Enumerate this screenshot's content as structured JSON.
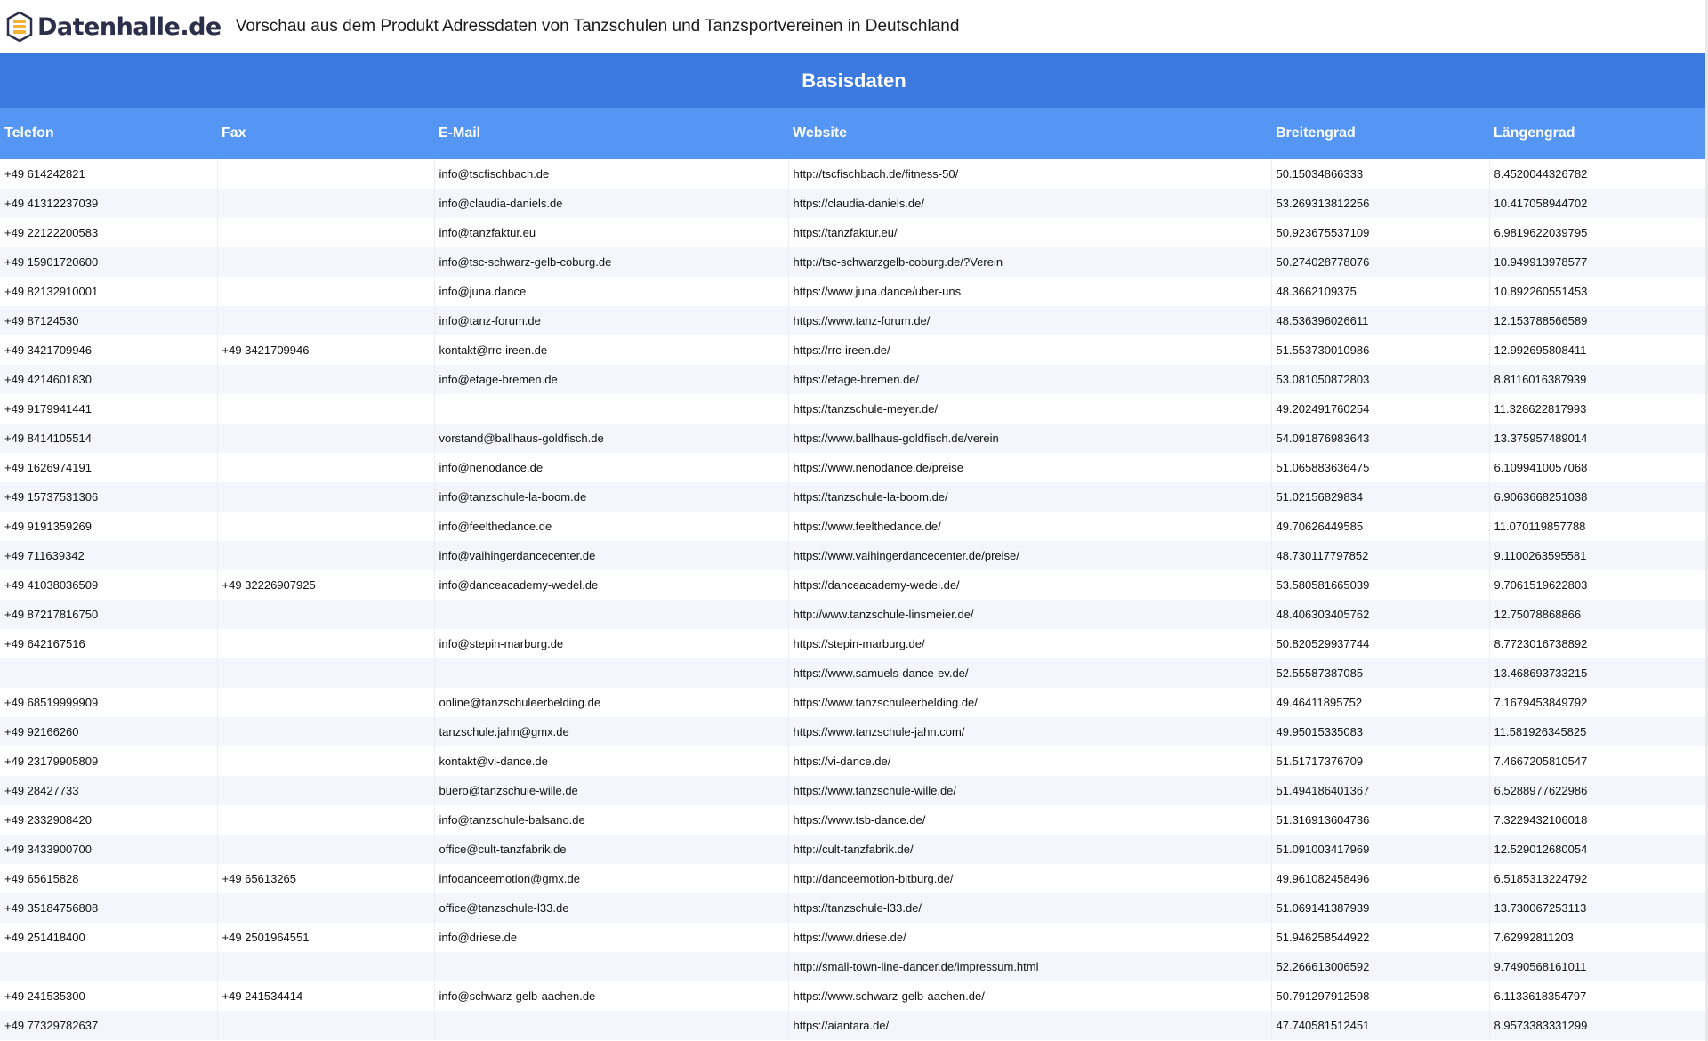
{
  "header": {
    "logo_text": "Datenhalle.de",
    "title": "Vorschau aus dem Produkt Adressdaten von Tanzschulen und Tanzsportvereinen in Deutschland"
  },
  "colors": {
    "section_header_bg": "#3c7ae0",
    "column_header_bg": "#5596f5",
    "row_alt_bg": "#f3f6fc"
  },
  "section": {
    "title": "Basisdaten"
  },
  "columns": [
    "Telefon",
    "Fax",
    "E-Mail",
    "Website",
    "Breitengrad",
    "Längengrad"
  ],
  "rows": [
    [
      "+49 614242821",
      "",
      "info@tscfischbach.de",
      "http://tscfischbach.de/fitness-50/",
      "50.15034866333",
      "8.4520044326782"
    ],
    [
      "+49 41312237039",
      "",
      "info@claudia-daniels.de",
      "https://claudia-daniels.de/",
      "53.269313812256",
      "10.417058944702"
    ],
    [
      "+49 22122200583",
      "",
      "info@tanzfaktur.eu",
      "https://tanzfaktur.eu/",
      "50.923675537109",
      "6.9819622039795"
    ],
    [
      "+49 15901720600",
      "",
      "info@tsc-schwarz-gelb-coburg.de",
      "http://tsc-schwarzgelb-coburg.de/?Verein",
      "50.274028778076",
      "10.949913978577"
    ],
    [
      "+49 82132910001",
      "",
      "info@juna.dance",
      "https://www.juna.dance/uber-uns",
      "48.3662109375",
      "10.892260551453"
    ],
    [
      "+49 87124530",
      "",
      "info@tanz-forum.de",
      "https://www.tanz-forum.de/",
      "48.536396026611",
      "12.153788566589"
    ],
    [
      "+49 3421709946",
      "+49 3421709946",
      "kontakt@rrc-ireen.de",
      "https://rrc-ireen.de/",
      "51.553730010986",
      "12.992695808411"
    ],
    [
      "+49 4214601830",
      "",
      "info@etage-bremen.de",
      "https://etage-bremen.de/",
      "53.081050872803",
      "8.8116016387939"
    ],
    [
      "+49 9179941441",
      "",
      "",
      "https://tanzschule-meyer.de/",
      "49.202491760254",
      "11.328622817993"
    ],
    [
      "+49 8414105514",
      "",
      "vorstand@ballhaus-goldfisch.de",
      "https://www.ballhaus-goldfisch.de/verein",
      "54.091876983643",
      "13.375957489014"
    ],
    [
      "+49 1626974191",
      "",
      "info@nenodance.de",
      "https://www.nenodance.de/preise",
      "51.065883636475",
      "6.1099410057068"
    ],
    [
      "+49 15737531306",
      "",
      "info@tanzschule-la-boom.de",
      "https://tanzschule-la-boom.de/",
      "51.02156829834",
      "6.9063668251038"
    ],
    [
      "+49 9191359269",
      "",
      "info@feelthedance.de",
      "https://www.feelthedance.de/",
      "49.70626449585",
      "11.070119857788"
    ],
    [
      "+49 711639342",
      "",
      "info@vaihingerdancecenter.de",
      "https://www.vaihingerdancecenter.de/preise/",
      "48.730117797852",
      "9.1100263595581"
    ],
    [
      "+49 41038036509",
      "+49 32226907925",
      "info@danceacademy-wedel.de",
      "https://danceacademy-wedel.de/",
      "53.580581665039",
      "9.7061519622803"
    ],
    [
      "+49 87217816750",
      "",
      "",
      "http://www.tanzschule-linsmeier.de/",
      "48.406303405762",
      "12.75078868866"
    ],
    [
      "+49 642167516",
      "",
      "info@stepin-marburg.de",
      "https://stepin-marburg.de/",
      "50.820529937744",
      "8.7723016738892"
    ],
    [
      "",
      "",
      "",
      "https://www.samuels-dance-ev.de/",
      "52.55587387085",
      "13.468693733215"
    ],
    [
      "+49 68519999909",
      "",
      "online@tanzschuleerbelding.de",
      "https://www.tanzschuleerbelding.de/",
      "49.46411895752",
      "7.1679453849792"
    ],
    [
      "+49 92166260",
      "",
      "tanzschule.jahn@gmx.de",
      "https://www.tanzschule-jahn.com/",
      "49.95015335083",
      "11.581926345825"
    ],
    [
      "+49 23179905809",
      "",
      "kontakt@vi-dance.de",
      "https://vi-dance.de/",
      "51.51717376709",
      "7.4667205810547"
    ],
    [
      "+49 28427733",
      "",
      "buero@tanzschule-wille.de",
      "https://www.tanzschule-wille.de/",
      "51.494186401367",
      "6.5288977622986"
    ],
    [
      "+49 2332908420",
      "",
      "info@tanzschule-balsano.de",
      "https://www.tsb-dance.de/",
      "51.316913604736",
      "7.3229432106018"
    ],
    [
      "+49 3433900700",
      "",
      "office@cult-tanzfabrik.de",
      "http://cult-tanzfabrik.de/",
      "51.091003417969",
      "12.529012680054"
    ],
    [
      "+49 65615828",
      "+49 65613265",
      "infodanceemotion@gmx.de",
      "http://danceemotion-bitburg.de/",
      "49.961082458496",
      "6.5185313224792"
    ],
    [
      "+49 35184756808",
      "",
      "office@tanzschule-l33.de",
      "https://tanzschule-l33.de/",
      "51.069141387939",
      "13.730067253113"
    ],
    [
      "+49 251418400",
      "+49 2501964551",
      "info@driese.de",
      "https://www.driese.de/",
      "51.946258544922",
      "7.62992811203"
    ],
    [
      "",
      "",
      "",
      "http://small-town-line-dancer.de/impressum.html",
      "52.266613006592",
      "9.7490568161011"
    ],
    [
      "+49 241535300",
      "+49 241534414",
      "info@schwarz-gelb-aachen.de",
      "https://www.schwarz-gelb-aachen.de/",
      "50.791297912598",
      "6.1133618354797"
    ],
    [
      "+49 77329782637",
      "",
      "",
      "https://aiantara.de/",
      "47.740581512451",
      "8.9573383331299"
    ]
  ]
}
